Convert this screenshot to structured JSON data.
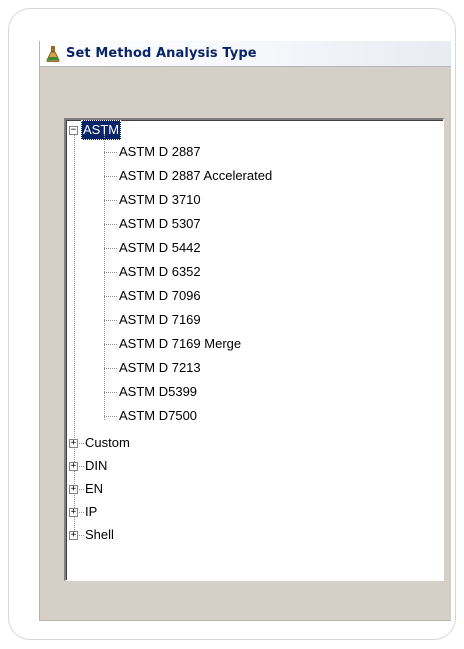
{
  "window": {
    "title": "Set Method Analysis Type",
    "title_icon": "flask-icon"
  },
  "tree": {
    "root": {
      "label": "ASTM",
      "expanded": true,
      "selected": true,
      "children": [
        "ASTM D 2887",
        "ASTM D 2887 Accelerated",
        "ASTM D 3710",
        "ASTM D 5307",
        "ASTM D 5442",
        "ASTM D 6352",
        "ASTM D 7096",
        "ASTM D 7169",
        "ASTM D 7169 Merge",
        "ASTM D 7213",
        "ASTM D5399",
        "ASTM D7500"
      ]
    },
    "collapsed_nodes": [
      "Custom",
      "DIN",
      "EN",
      "IP",
      "Shell"
    ],
    "expand_symbol": "+",
    "collapse_symbol": "−"
  },
  "colors": {
    "title_text": "#0a246a",
    "selection_bg": "#0a246a",
    "window_bg": "#d4d0c8"
  }
}
